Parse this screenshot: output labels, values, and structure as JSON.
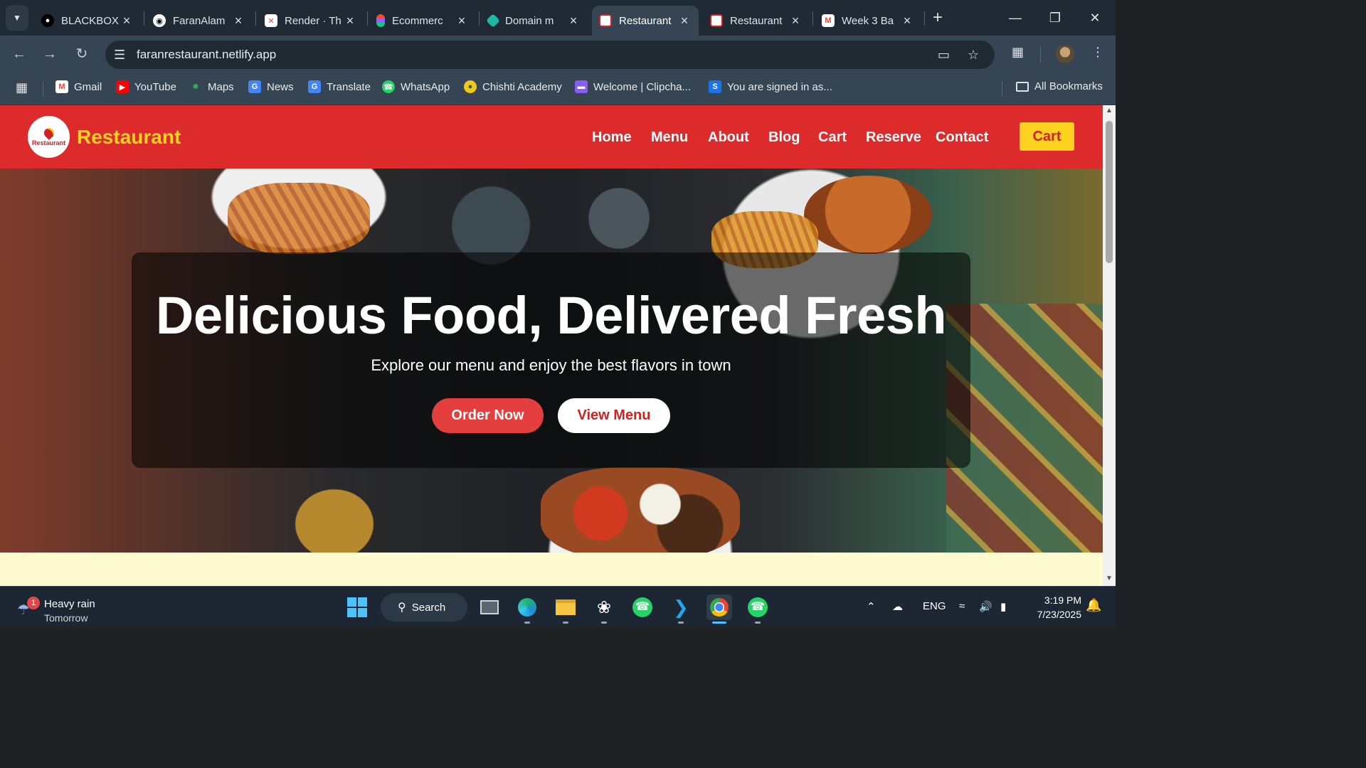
{
  "browser": {
    "tabs": [
      {
        "title": "BLACKBOX",
        "icon": "blackbox-icon",
        "active": false
      },
      {
        "title": "FaranAlam",
        "icon": "github-icon",
        "active": false
      },
      {
        "title": "Render · Th",
        "icon": "render-icon",
        "active": false
      },
      {
        "title": "Ecommerc",
        "icon": "figma-icon",
        "active": false
      },
      {
        "title": "Domain m",
        "icon": "netlify-icon",
        "active": false
      },
      {
        "title": "Restaurant",
        "icon": "restaurant-icon",
        "active": true
      },
      {
        "title": "Restaurant",
        "icon": "restaurant-icon",
        "active": false
      },
      {
        "title": "Week 3 Ba",
        "icon": "gmail-icon",
        "active": false
      }
    ],
    "url": "faranrestaurant.netlify.app",
    "bookmarks": [
      {
        "label": "Gmail",
        "icon": "gmail-icon",
        "color": "#ea4335"
      },
      {
        "label": "YouTube",
        "icon": "youtube-icon",
        "color": "#ff0000"
      },
      {
        "label": "Maps",
        "icon": "maps-icon",
        "color": "#34a853"
      },
      {
        "label": "News",
        "icon": "news-icon",
        "color": "#4285f4"
      },
      {
        "label": "Translate",
        "icon": "translate-icon",
        "color": "#4285f4"
      },
      {
        "label": "WhatsApp",
        "icon": "whatsapp-icon",
        "color": "#25d366"
      },
      {
        "label": "Chishti Academy",
        "icon": "chishti-icon",
        "color": "#f3c61c"
      },
      {
        "label": "Welcome | Clipcha...",
        "icon": "clipchamp-icon",
        "color": "#8a5cf6"
      },
      {
        "label": "You are signed in as...",
        "icon": "signin-icon",
        "color": "#1a73e8"
      }
    ],
    "all_bookmarks": "All Bookmarks"
  },
  "site": {
    "logo_text": "Restaurant",
    "brand": "Restaurant",
    "nav": [
      "Home",
      "Menu",
      "About",
      "Blog",
      "Cart",
      "Reserve",
      "Contact"
    ],
    "cart_button": "Cart",
    "hero": {
      "title": "Delicious Food, Delivered Fresh",
      "subtitle": "Explore our menu and enjoy the best flavors in town",
      "primary_cta": "Order Now",
      "secondary_cta": "View Menu"
    },
    "colors": {
      "header": "#dd2b2b",
      "brand": "#ffd21f",
      "cta": "#e53e3e",
      "below_hero": "#fffbd0"
    }
  },
  "taskbar": {
    "weather_title": "Heavy rain",
    "weather_sub": "Tomorrow",
    "weather_badge": "1",
    "search": "Search",
    "lang": "ENG",
    "time": "3:19 PM",
    "date": "7/23/2025"
  }
}
